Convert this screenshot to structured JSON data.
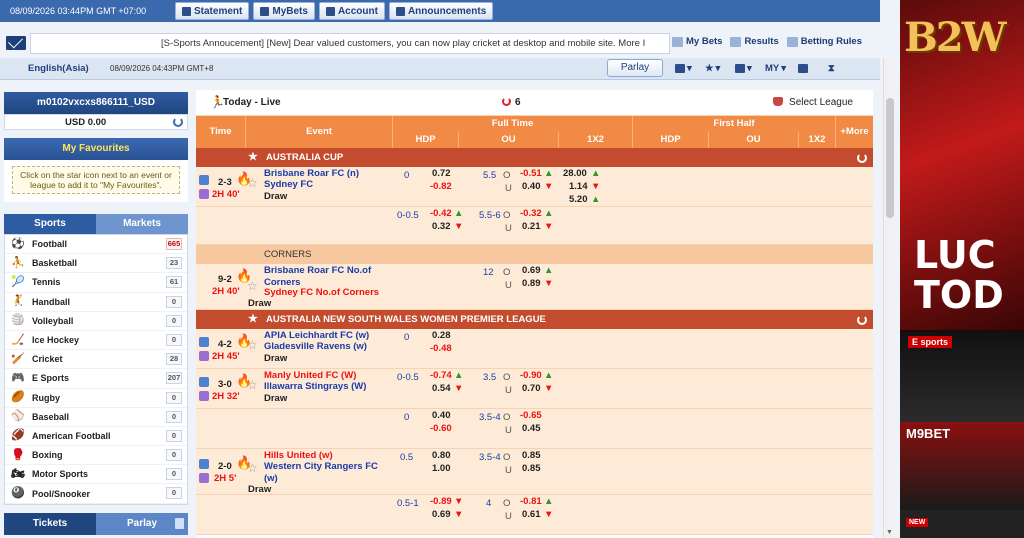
{
  "topbar": {
    "clock": "08/09/2026 03:44PM GMT +07:00",
    "statement": "Statement",
    "mybets": "MyBets",
    "account": "Account",
    "announcements": "Announcements"
  },
  "announce": {
    "text": "[S-Sports Annoucement] [New] Dear valued customers, you can now play cricket at desktop and mobile site. More I",
    "links": {
      "mybets": "My Bets",
      "results": "Results",
      "rules": "Betting Rules"
    }
  },
  "sub": {
    "lang": "English(Asia)",
    "time": "08/09/2026 04:43PM GMT+8",
    "parlay": "Parlay",
    "myodds": "MY"
  },
  "sidebar": {
    "account": "m0102vxcxs866111_USD",
    "balance": "USD 0.00",
    "fav_title": "My Favourites",
    "fav_hint": "Click on the star icon next to an event or league to add it to \"My Favourites\".",
    "tab_sports": "Sports",
    "tab_markets": "Markets",
    "sports": [
      {
        "icon": "⚽",
        "name": "Football",
        "count": "665"
      },
      {
        "icon": "⛹",
        "name": "Basketball",
        "count": "23"
      },
      {
        "icon": "🎾",
        "name": "Tennis",
        "count": "61"
      },
      {
        "icon": "🤾",
        "name": "Handball",
        "count": "0"
      },
      {
        "icon": "🏐",
        "name": "Volleyball",
        "count": "0"
      },
      {
        "icon": "🏒",
        "name": "Ice Hockey",
        "count": "0"
      },
      {
        "icon": "🏏",
        "name": "Cricket",
        "count": "28"
      },
      {
        "icon": "🎮",
        "name": "E Sports",
        "count": "207"
      },
      {
        "icon": "🏉",
        "name": "Rugby",
        "count": "0"
      },
      {
        "icon": "⚾",
        "name": "Baseball",
        "count": "0"
      },
      {
        "icon": "🏈",
        "name": "American Football",
        "count": "0"
      },
      {
        "icon": "🥊",
        "name": "Boxing",
        "count": "0"
      },
      {
        "icon": "🏍",
        "name": "Motor Sports",
        "count": "0"
      },
      {
        "icon": "🎱",
        "name": "Pool/Snooker",
        "count": "0"
      }
    ],
    "tickets": "Tickets",
    "parlay": "Parlay"
  },
  "main": {
    "title": "Today - Live",
    "count": "6",
    "select_league": "Select League",
    "headers": {
      "time": "Time",
      "event": "Event",
      "fulltime": "Full Time",
      "firsthalf": "First Half",
      "hdp": "HDP",
      "ou": "OU",
      "x12": "1X2",
      "hdp2": "HDP",
      "ou2": "OU",
      "x122": "1X2",
      "more": "+More"
    },
    "leagues": {
      "l1": "AUSTRALIA CUP",
      "l2": "CORNERS",
      "l3": "AUSTRALIA NEW SOUTH WALES WOMEN PREMIER LEAGUE"
    },
    "m1": {
      "score": "2-3",
      "period": "2H 40'",
      "home": "Brisbane Roar FC (n)",
      "away": "Sydney FC",
      "draw": "Draw",
      "hc1": "0",
      "h1": "0.72",
      "a1": "-0.82",
      "ou1": "5.5",
      "o1": "-0.51",
      "u1": "0.40",
      "x1": "28.00",
      "x2": "1.14",
      "x3": "5.20",
      "hc2": "0-0.5",
      "h2": "-0.42",
      "a2": "0.32",
      "ou2": "5.5-6",
      "o2": "-0.32",
      "u2": "0.21"
    },
    "m2": {
      "score": "9-2",
      "period": "2H 40'",
      "home": "Brisbane Roar FC No.of Corners",
      "away": "Sydney FC No.of Corners",
      "draw": "Draw",
      "ou1": "12",
      "o1": "0.69",
      "u1": "0.89"
    },
    "m3": {
      "score": "4-2",
      "period": "2H 45'",
      "home": "APIA Leichhardt FC (w)",
      "away": "Gladesville Ravens (w)",
      "draw": "Draw",
      "hc1": "0",
      "h1": "0.28",
      "a1": "-0.48"
    },
    "m4": {
      "score": "3-0",
      "period": "2H 32'",
      "home": "Manly United FC (W)",
      "away": "Illawarra Stingrays (W)",
      "draw": "Draw",
      "hc1": "0-0.5",
      "h1": "-0.74",
      "a1": "0.54",
      "ou1": "3.5",
      "o1": "-0.90",
      "u1": "0.70",
      "hc2": "0",
      "h2": "0.40",
      "a2": "-0.60",
      "ou2": "3.5-4",
      "o2": "-0.65",
      "u2": "0.45"
    },
    "m5": {
      "score": "2-0",
      "period": "2H 5'",
      "home": "Hills United (w)",
      "away": "Western City Rangers FC (w)",
      "draw": "Draw",
      "hc1": "0.5",
      "h1": "0.80",
      "a1": "1.00",
      "ou1": "3.5-4",
      "o1": "0.85",
      "u1": "0.85",
      "hc2": "0.5-1",
      "h2": "-0.89",
      "a2": "0.69",
      "ou2": "4",
      "o2": "-0.81",
      "u2": "0.61"
    },
    "o": "O",
    "u": "U"
  },
  "ad": {
    "logo": "B2W",
    "luc": "LUC",
    "tod": "TOD",
    "esports": "E sports",
    "m9": "M9BET",
    "new": "NEW"
  }
}
